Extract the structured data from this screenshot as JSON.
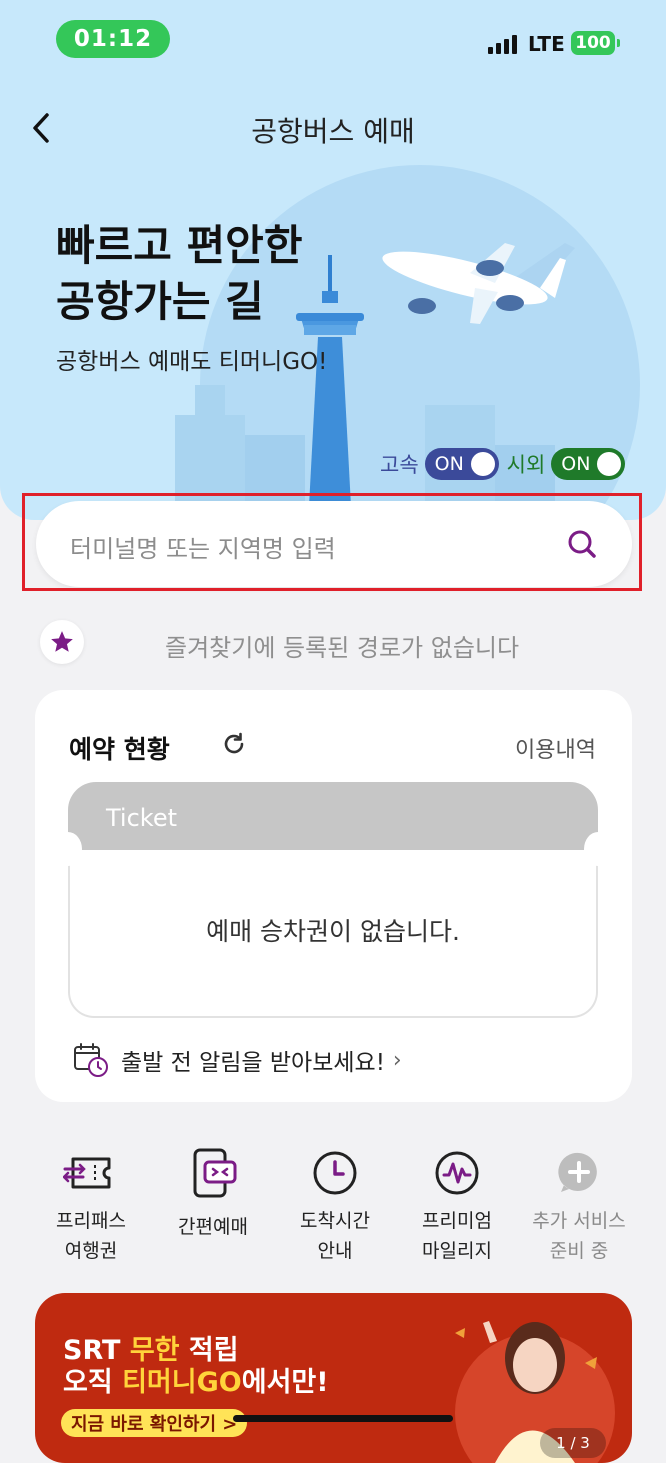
{
  "status_bar": {
    "time": "01:12",
    "network": "LTE",
    "battery": "100"
  },
  "header": {
    "title": "공항버스 예매",
    "back_icon": "chevron-left-icon"
  },
  "hero": {
    "headline_line1": "빠르고 편안한",
    "headline_line2": "공항가는 길",
    "subline": "공항버스 예매도 티머니GO!",
    "toggles": [
      {
        "label": "고속",
        "state": "ON",
        "color": "#3b4a9a",
        "label_color": "#3b4a9a"
      },
      {
        "label": "시외",
        "state": "ON",
        "color": "#1f7a2a",
        "label_color": "#1f7a2a"
      }
    ]
  },
  "search": {
    "placeholder": "터미널명 또는 지역명 입력",
    "icon": "search-icon",
    "accent": "#7b1c86"
  },
  "favorites": {
    "empty_text": "즐겨찾기에 등록된 경로가 없습니다",
    "icon": "star-icon",
    "color": "#7b1c86"
  },
  "reservation": {
    "title": "예약 현황",
    "history_link": "이용내역",
    "ticket_label": "Ticket",
    "empty_text": "예매 승차권이 없습니다.",
    "alarm_text": "출발 전 알림을 받아보세요!"
  },
  "menu": [
    {
      "label_line1": "프리패스",
      "label_line2": "여행권",
      "icon": "free-pass-ticket-icon",
      "active": true
    },
    {
      "label_line1": "간편예매",
      "label_line2": "",
      "icon": "quick-booking-phone-icon",
      "active": true
    },
    {
      "label_line1": "도착시간",
      "label_line2": "안내",
      "icon": "clock-icon",
      "active": true
    },
    {
      "label_line1": "프리미엄",
      "label_line2": "마일리지",
      "icon": "mileage-icon",
      "active": true
    },
    {
      "label_line1": "추가 서비스",
      "label_line2": "준비 중",
      "icon": "plus-chat-icon",
      "active": false
    }
  ],
  "banner": {
    "line1_pre": "SRT ",
    "line1_hl": "무한",
    "line1_post": " 적립",
    "line2_pre": "오직 ",
    "line2_hl": "티머니GO",
    "line2_post": "에서만!",
    "cta": "지금 바로 확인하기 >",
    "page": "1 / 3"
  }
}
